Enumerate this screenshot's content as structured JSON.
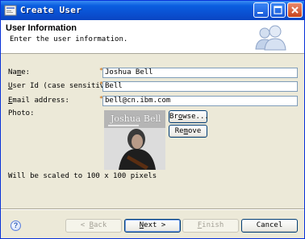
{
  "window": {
    "title": "Create User",
    "accent": "#0a4fd0"
  },
  "header": {
    "title": "User Information",
    "description": "Enter the user information.",
    "icon": "users-icon"
  },
  "form": {
    "name": {
      "label_pre": "Na",
      "label_mn": "m",
      "label_post": "e:",
      "value": "Joshua Bell"
    },
    "user_id": {
      "label_pre": "",
      "label_mn": "U",
      "label_post": "ser Id (case sensitive):",
      "value": "Bell"
    },
    "email": {
      "label_pre": "",
      "label_mn": "E",
      "label_post": "mail address:",
      "value": "bell@cn.ibm.com"
    },
    "photo": {
      "label": "Photo:",
      "image_caption": "Joshua Bell"
    },
    "required_marker": "*",
    "scale_note": "Will be scaled to 100 x 100 pixels"
  },
  "buttons": {
    "browse": {
      "pre": "Br",
      "mn": "o",
      "post": "wse..."
    },
    "remove": {
      "pre": "Re",
      "mn": "m",
      "post": "ove"
    },
    "back": {
      "pre": "< ",
      "mn": "B",
      "post": "ack"
    },
    "next": {
      "pre": "",
      "mn": "N",
      "post": "ext >"
    },
    "finish": {
      "pre": "",
      "mn": "F",
      "post": "inish"
    },
    "cancel": {
      "label": "Cancel"
    },
    "help": "?"
  }
}
